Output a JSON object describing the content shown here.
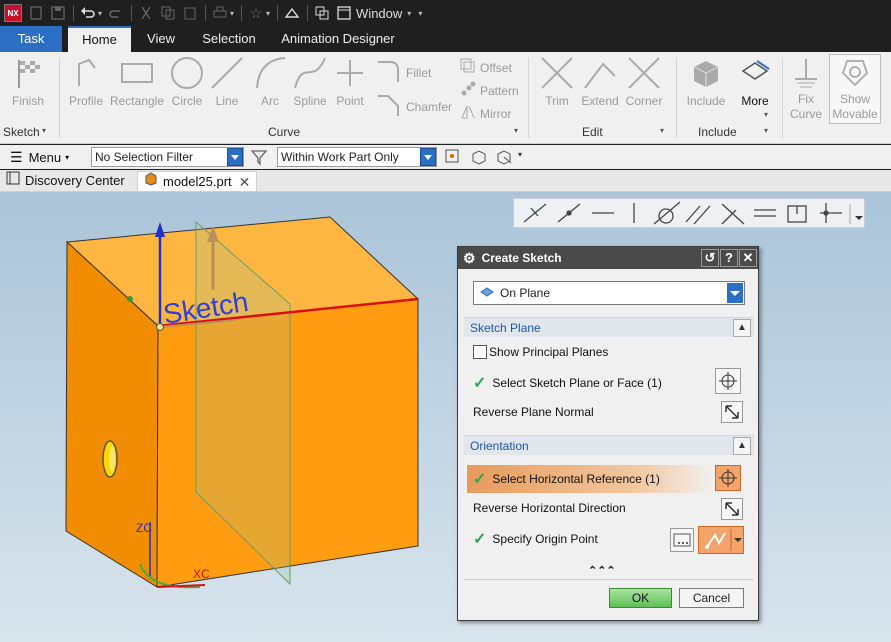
{
  "app": {
    "logo": "NX",
    "window_label": "Window"
  },
  "tabs": [
    "Task",
    "Home",
    "View",
    "Selection",
    "Animation Designer"
  ],
  "ribbon": {
    "finish": "Finish",
    "sketch_group": "Sketch",
    "curve_items": [
      "Profile",
      "Rectangle",
      "Circle",
      "Line",
      "Arc",
      "Spline",
      "Point"
    ],
    "fillet": "Fillet",
    "chamfer": "Chamfer",
    "offset": "Offset",
    "pattern": "Pattern",
    "mirror": "Mirror",
    "curve_group": "Curve",
    "edit_items": [
      "Trim",
      "Extend",
      "Corner"
    ],
    "edit_group": "Edit",
    "include": "Include",
    "more": "More",
    "include_group": "Include",
    "fix_curve_1": "Fix",
    "fix_curve_2": "Curve",
    "show_movable_1": "Show",
    "show_movable_2": "Movable"
  },
  "filterbar": {
    "menu": "Menu",
    "selection_filter": "No Selection Filter",
    "scope": "Within Work Part Only"
  },
  "doc_tabs": [
    "Discovery Center",
    "model25.prt"
  ],
  "viewport": {
    "sketch_label": "Sketch",
    "axis_zc": "ZC",
    "axis_xc": "XC"
  },
  "dialog": {
    "title": "Create Sketch",
    "type_value": "On Plane",
    "section_plane": "Sketch Plane",
    "show_principal_planes": "Show Principal Planes",
    "select_plane": "Select Sketch Plane or Face (1)",
    "reverse_plane_normal": "Reverse Plane Normal",
    "section_orientation": "Orientation",
    "select_horizontal_ref": "Select Horizontal Reference (1)",
    "reverse_horizontal": "Reverse Horizontal Direction",
    "specify_origin": "Specify Origin Point",
    "ok": "OK",
    "cancel": "Cancel"
  },
  "colors": {
    "accent": "#2b6fc4",
    "cube": "#ff9f1a",
    "check": "#2da84a",
    "highlight": "#e79a5a"
  }
}
